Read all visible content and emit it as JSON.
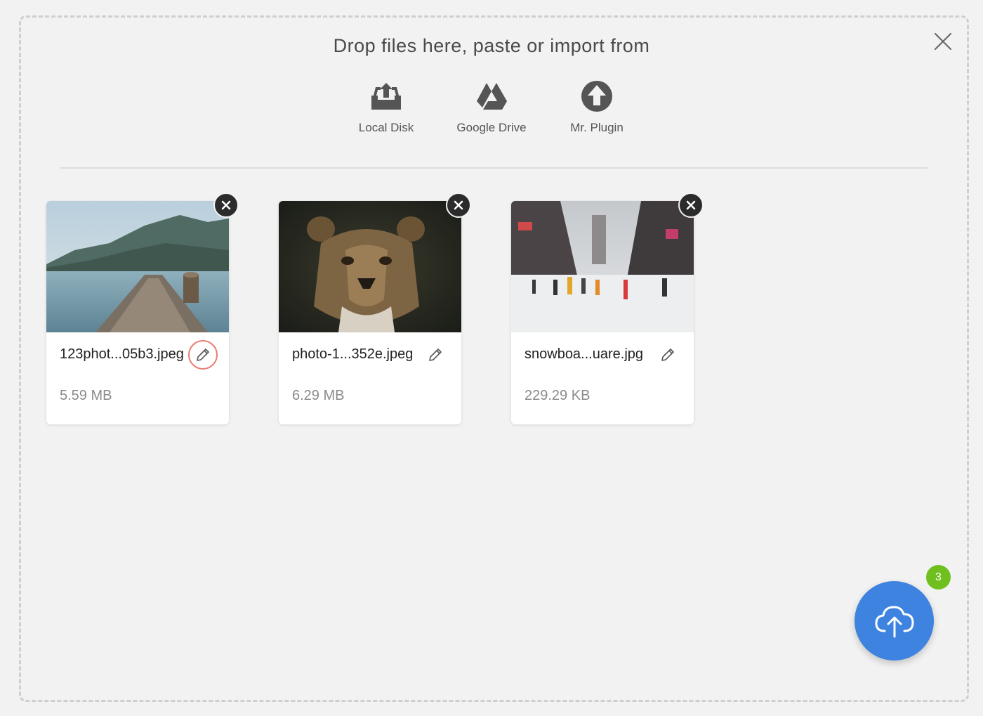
{
  "dropzone": {
    "heading": "Drop files here, paste or import from",
    "sources": [
      {
        "label": "Local Disk",
        "icon": "local-disk-icon"
      },
      {
        "label": "Google Drive",
        "icon": "google-drive-icon"
      },
      {
        "label": "Mr. Plugin",
        "icon": "upload-arrow-icon"
      }
    ]
  },
  "files": [
    {
      "name": "123phot...05b3.jpeg",
      "size": "5.59 MB",
      "thumbnail": "lake-pier-photo"
    },
    {
      "name": "photo-1...352e.jpeg",
      "size": "6.29 MB",
      "thumbnail": "lioness-photo"
    },
    {
      "name": "snowboa...uare.jpg",
      "size": "229.29 KB",
      "thumbnail": "snowy-street-photo"
    }
  ],
  "upload": {
    "badge_count": "3"
  },
  "colors": {
    "accent": "#3e83e0",
    "badge": "#6fc01f",
    "focus_ring": "#e87e72",
    "background": "#f2f2f2"
  }
}
